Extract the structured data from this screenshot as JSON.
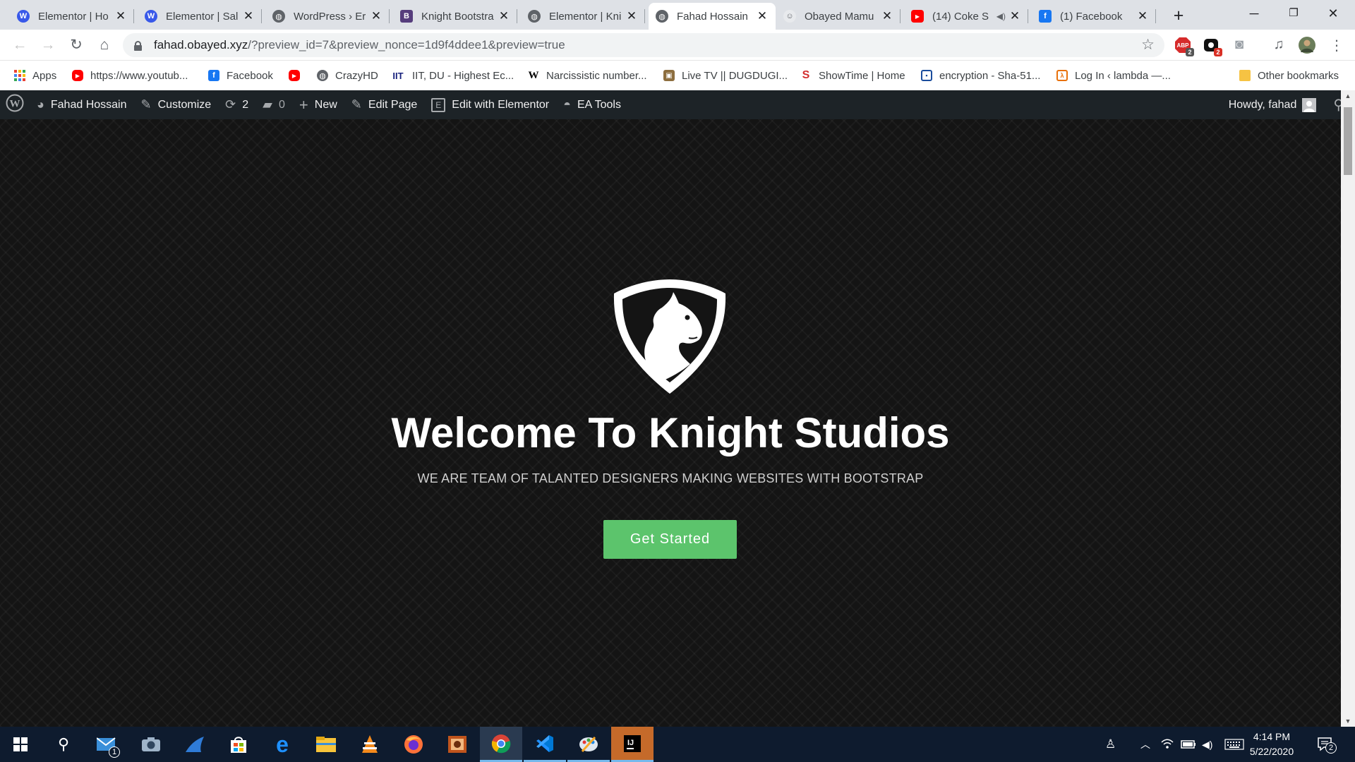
{
  "browser": {
    "tabs": [
      {
        "title": "Elementor | Ho",
        "icon": "wordpress-icon",
        "active": false
      },
      {
        "title": "Elementor | Sal",
        "icon": "wordpress-icon",
        "active": false
      },
      {
        "title": "WordPress › Er",
        "icon": "globe-icon",
        "active": false
      },
      {
        "title": "Knight Bootstra",
        "icon": "bootstrap-icon",
        "active": false
      },
      {
        "title": "Elementor | Kni",
        "icon": "globe-icon",
        "active": false
      },
      {
        "title": "Fahad Hossain",
        "icon": "globe-icon",
        "active": true
      },
      {
        "title": "Obayed Mamu",
        "icon": "profile-icon",
        "active": false
      },
      {
        "title": "(14) Coke S",
        "icon": "youtube-icon",
        "active": false
      },
      {
        "title": "(1) Facebook",
        "icon": "facebook-icon",
        "active": false
      }
    ],
    "new_tab": "+",
    "url_host": "fahad.obayed.xyz",
    "url_path": "/?preview_id=7&preview_nonce=1d9f4ddee1&preview=true",
    "extensions": {
      "abp_badge": "2",
      "ext2_badge": "2"
    }
  },
  "bookmarks": [
    {
      "label": "Apps",
      "icon": "apps-grid-icon"
    },
    {
      "label": "https://www.youtub...",
      "icon": "youtube-icon"
    },
    {
      "label": "Facebook",
      "icon": "facebook-icon"
    },
    {
      "label": "",
      "icon": "youtube-icon"
    },
    {
      "label": "CrazyHD",
      "icon": "globe-icon"
    },
    {
      "label": "IIT, DU - Highest Ec...",
      "icon": "iit-icon"
    },
    {
      "label": "Narcissistic number...",
      "icon": "wikipedia-icon"
    },
    {
      "label": "Live TV || DUGDUGI...",
      "icon": "tv-icon"
    },
    {
      "label": "ShowTime | Home",
      "icon": "showtime-icon"
    },
    {
      "label": "encryption - Sha-51...",
      "icon": "crypto-icon"
    },
    {
      "label": "Log In ‹ lambda —...",
      "icon": "lambda-icon"
    },
    {
      "label": "Other bookmarks",
      "icon": "folder-icon"
    }
  ],
  "wp_admin_bar": {
    "site_name": "Fahad Hossain",
    "customize": "Customize",
    "updates_count": "2",
    "comments_count": "0",
    "new": "New",
    "edit_page": "Edit Page",
    "edit_with_elementor": "Edit with Elementor",
    "ea_tools": "EA Tools",
    "howdy": "Howdy, fahad"
  },
  "hero": {
    "title": "Welcome To Knight Studios",
    "subtitle": "WE ARE TEAM OF TALANTED DESIGNERS MAKING WEBSITES WITH BOOTSTRAP",
    "cta_label": "Get Started",
    "cta_color": "#5cc46c",
    "background_color": "#141414"
  },
  "taskbar": {
    "mail_badge": "1",
    "time": "4:14 PM",
    "date": "5/22/2020",
    "notification_count": "2"
  }
}
